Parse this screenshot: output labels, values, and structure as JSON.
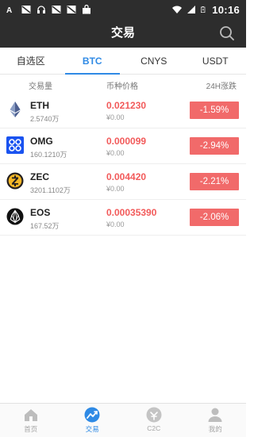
{
  "status_bar": {
    "time": "10:16",
    "left_icons": [
      "font-a-icon",
      "mail-icon",
      "headset-icon",
      "mail-icon",
      "mail-icon",
      "shopping-bag-icon"
    ],
    "right_icons": [
      "wifi-icon",
      "signal-icon",
      "battery-icon"
    ]
  },
  "nav": {
    "title": "交易",
    "search_icon": "search-icon"
  },
  "tabs": [
    {
      "label": "自选区",
      "active": false
    },
    {
      "label": "BTC",
      "active": true
    },
    {
      "label": "CNYS",
      "active": false
    },
    {
      "label": "USDT",
      "active": false
    }
  ],
  "columns": {
    "volume": "交易量",
    "price": "币种价格",
    "change": "24H涨跌"
  },
  "coins": [
    {
      "name": "ETH",
      "volume": "2.5740万",
      "price": "0.021230",
      "cny": "¥0.00",
      "change": "-1.59%",
      "icon": "ethereum-icon"
    },
    {
      "name": "OMG",
      "volume": "160.1210万",
      "price": "0.000099",
      "cny": "¥0.00",
      "change": "-2.94%",
      "icon": "omisego-icon"
    },
    {
      "name": "ZEC",
      "volume": "3201.1102万",
      "price": "0.004420",
      "cny": "¥0.00",
      "change": "-2.21%",
      "icon": "zcash-icon"
    },
    {
      "name": "EOS",
      "volume": "167.52万",
      "price": "0.00035390",
      "cny": "¥0.00",
      "change": "-2.06%",
      "icon": "eos-icon"
    }
  ],
  "bottom_nav": [
    {
      "label": "首页",
      "icon": "home-icon",
      "active": false
    },
    {
      "label": "交易",
      "icon": "trade-icon",
      "active": true
    },
    {
      "label": "C2C",
      "icon": "c2c-icon",
      "active": false
    },
    {
      "label": "我的",
      "icon": "profile-icon",
      "active": false
    }
  ],
  "colors": {
    "header_bg": "#2d2d2d",
    "accent": "#2f8ae5",
    "price_red": "#f25a5a",
    "change_bg": "#f16a6a"
  }
}
